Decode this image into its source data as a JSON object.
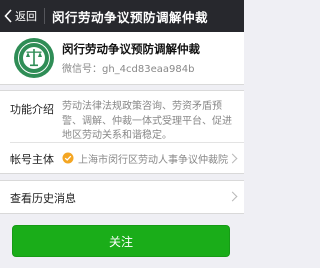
{
  "topbar": {
    "back_label": "返回",
    "title": "闵行劳动争议预防调解仲裁"
  },
  "profile": {
    "name": "闵行劳动争议预防调解仲裁",
    "wechat_id": "微信号：gh_4cd83eaa984b"
  },
  "intro": {
    "label": "功能介绍",
    "text": "劳动法律法规政策咨询、劳资矛盾预警、调解、仲裁一体式受理平台、促进地区劳动关系和谐稳定。"
  },
  "entity": {
    "label": "帐号主体",
    "value": "上海市闵行区劳动人事争议仲裁院"
  },
  "history": {
    "label": "查看历史消息"
  },
  "follow_button": {
    "label": "关注"
  },
  "colors": {
    "topbar": "#27282d",
    "accent_green": "#1aad19",
    "logo_green": "#2f8d56",
    "verified_orange": "#f4a623"
  }
}
